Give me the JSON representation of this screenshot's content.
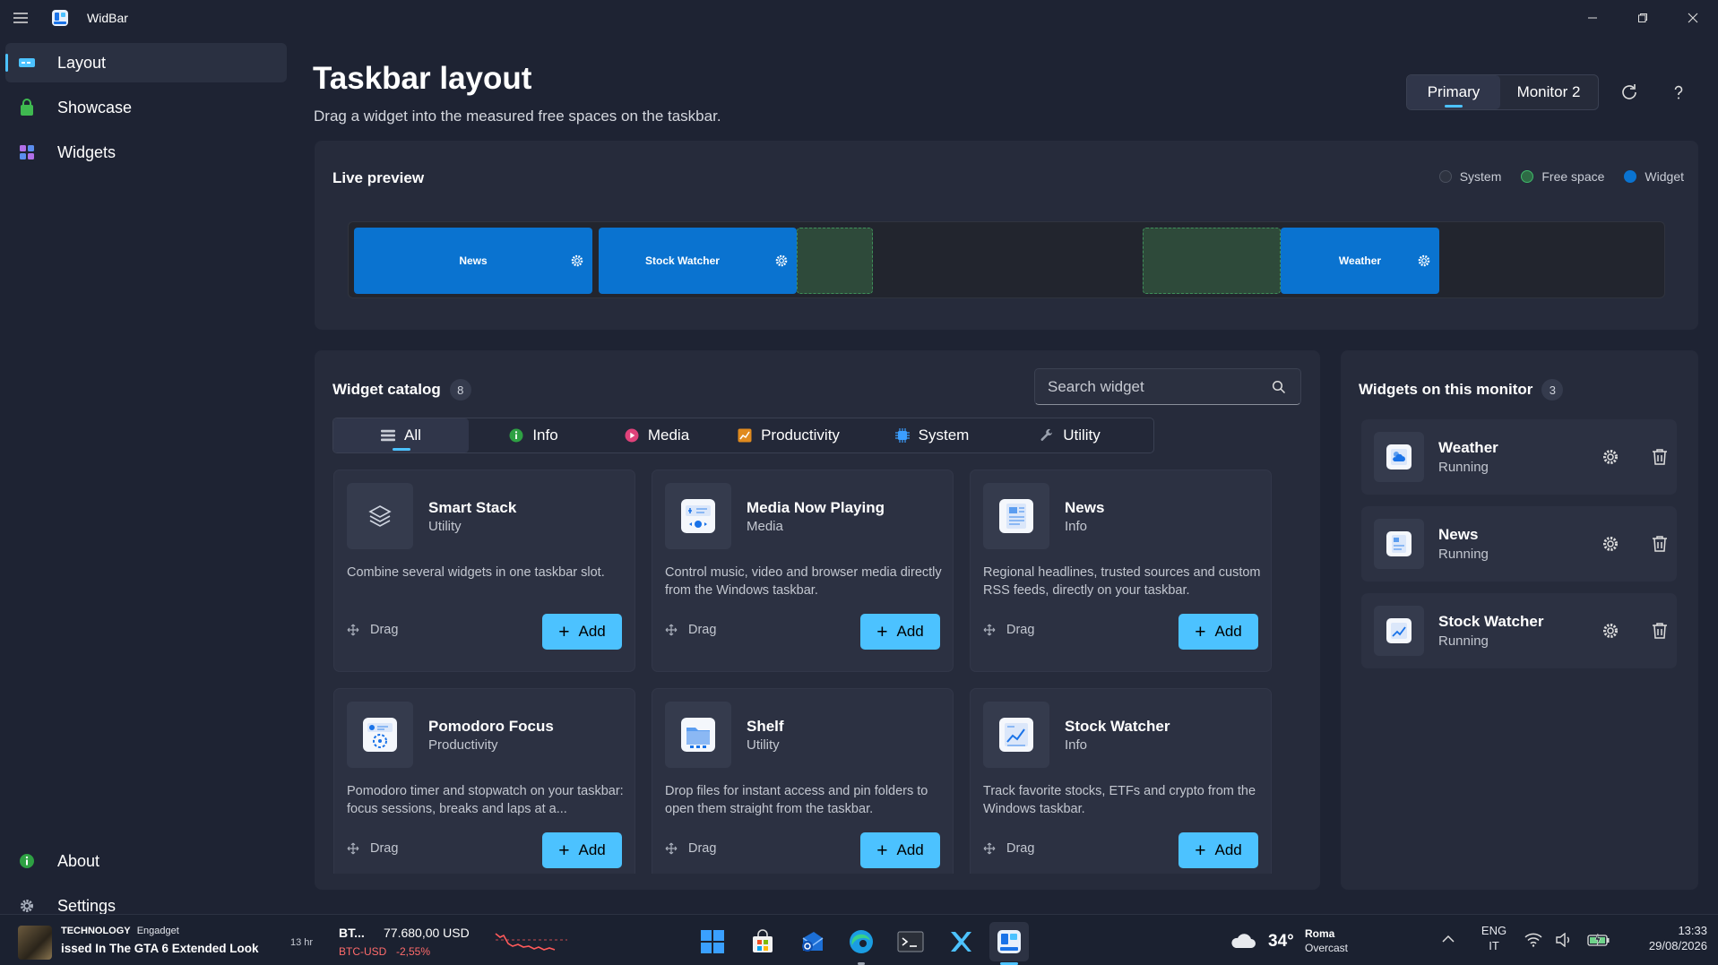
{
  "app": {
    "title": "WidBar"
  },
  "sidebar": {
    "items": [
      {
        "label": "Layout",
        "icon": "taskbar-icon"
      },
      {
        "label": "Showcase",
        "icon": "bag-icon"
      },
      {
        "label": "Widgets",
        "icon": "widgets-icon"
      }
    ],
    "footer": [
      {
        "label": "About",
        "icon": "info-icon"
      },
      {
        "label": "Settings",
        "icon": "gear-icon"
      }
    ]
  },
  "header": {
    "title": "Taskbar layout",
    "subtitle": "Drag a widget into the measured free spaces on the taskbar.",
    "monitors": [
      "Primary",
      "Monitor 2"
    ],
    "selected_monitor": "Primary"
  },
  "preview": {
    "title": "Live preview",
    "legend": [
      {
        "label": "System",
        "color": "#3a3f4c"
      },
      {
        "label": "Free space",
        "color": "#2e6b45"
      },
      {
        "label": "Widget",
        "color": "#0a73d0"
      }
    ],
    "widgets": [
      "News",
      "Stock Watcher",
      "Weather"
    ]
  },
  "catalog": {
    "title": "Widget catalog",
    "count": "8",
    "search_placeholder": "Search widget",
    "tabs": [
      "All",
      "Info",
      "Media",
      "Productivity",
      "System",
      "Utility"
    ],
    "selected_tab": "All",
    "drag_label": "Drag",
    "add_label": "Add",
    "items": [
      {
        "title": "Smart Stack",
        "category": "Utility",
        "desc": "Combine several widgets in one taskbar slot."
      },
      {
        "title": "Media Now Playing",
        "category": "Media",
        "desc": "Control music, video and browser media directly from the Windows taskbar."
      },
      {
        "title": "News",
        "category": "Info",
        "desc": "Regional headlines, trusted sources and custom RSS feeds, directly on your taskbar."
      },
      {
        "title": "Pomodoro Focus",
        "category": "Productivity",
        "desc": "Pomodoro timer and stopwatch on your taskbar: focus sessions, breaks and laps at a..."
      },
      {
        "title": "Shelf",
        "category": "Utility",
        "desc": "Drop files for instant access and pin folders to open them straight from the taskbar."
      },
      {
        "title": "Stock Watcher",
        "category": "Info",
        "desc": "Track favorite stocks, ETFs and crypto from the Windows taskbar."
      }
    ]
  },
  "monitor": {
    "title": "Widgets on this monitor",
    "count": "3",
    "items": [
      {
        "title": "Weather",
        "status": "Running"
      },
      {
        "title": "News",
        "status": "Running"
      },
      {
        "title": "Stock Watcher",
        "status": "Running"
      }
    ]
  },
  "taskbar": {
    "news": {
      "tag": "TECHNOLOGY",
      "source": "Engadget",
      "headline": "issed In The GTA 6 Extended Look",
      "age": "13 hr"
    },
    "stock": {
      "symbol": "BT...",
      "price": "77.680,00 USD",
      "pair": "BTC-USD",
      "change": "-2,55%"
    },
    "weather": {
      "temp": "34°",
      "city": "Roma",
      "condition": "Overcast"
    },
    "lang": {
      "line1": "ENG",
      "line2": "IT"
    },
    "clock": {
      "time": "13:33",
      "date": "29/08/2026"
    }
  }
}
